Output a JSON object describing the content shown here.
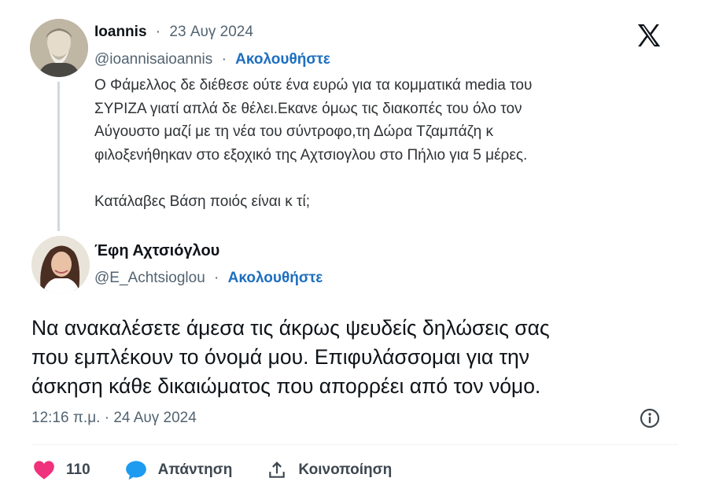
{
  "original_tweet": {
    "author_name": "Ioannis",
    "date": "23 Αυγ 2024",
    "handle": "@ioannisaioannis",
    "follow_label": "Ακολουθήστε",
    "lines": [
      "Ο Φάμελλος δε διέθεσε ούτε ένα ευρώ για τα κομματικά media του",
      "ΣΥΡΙΖΑ γιατί απλά δε θέλει.Εκανε όμως τις διακοπές του όλο τον",
      "Αύγουστο μαζί με τη νέα του σύντροφο,τη Δώρα Τζαμπάζη κ",
      "φιλοξενήθηκαν στο εξοχικό της Αχτσιογλου στο Πήλιο για 5 μέρες."
    ],
    "last_line": "Κατάλαβες Βάση ποιός είναι κ τί;"
  },
  "reply_tweet": {
    "author_name": "Έφη Αχτσιόγλου",
    "handle": "@E_Achtsioglou",
    "follow_label": "Ακολουθήστε",
    "lines": [
      "Να ανακαλέσετε άμεσα τις άκρως ψευδείς δηλώσεις σας",
      "που εμπλέκουν το όνομά μου. Επιφυλάσσομαι για την",
      "άσκηση κάθε δικαιώματος που απορρέει από τον νόμο."
    ],
    "timestamp": "12:16 π.μ. · 24 Αυγ 2024"
  },
  "separator": "·",
  "actions": {
    "likes_count": "110",
    "reply_label": "Απάντηση",
    "share_label": "Κοινοποίηση"
  },
  "icons": {
    "brand": "x-logo-icon",
    "like": "heart-icon",
    "reply": "speech-bubble-icon",
    "share": "share-upload-icon",
    "info": "info-icon"
  },
  "colors": {
    "like": "#f0317b",
    "reply": "#1d9bf0",
    "follow": "#1d6fbf",
    "muted": "#536471"
  }
}
